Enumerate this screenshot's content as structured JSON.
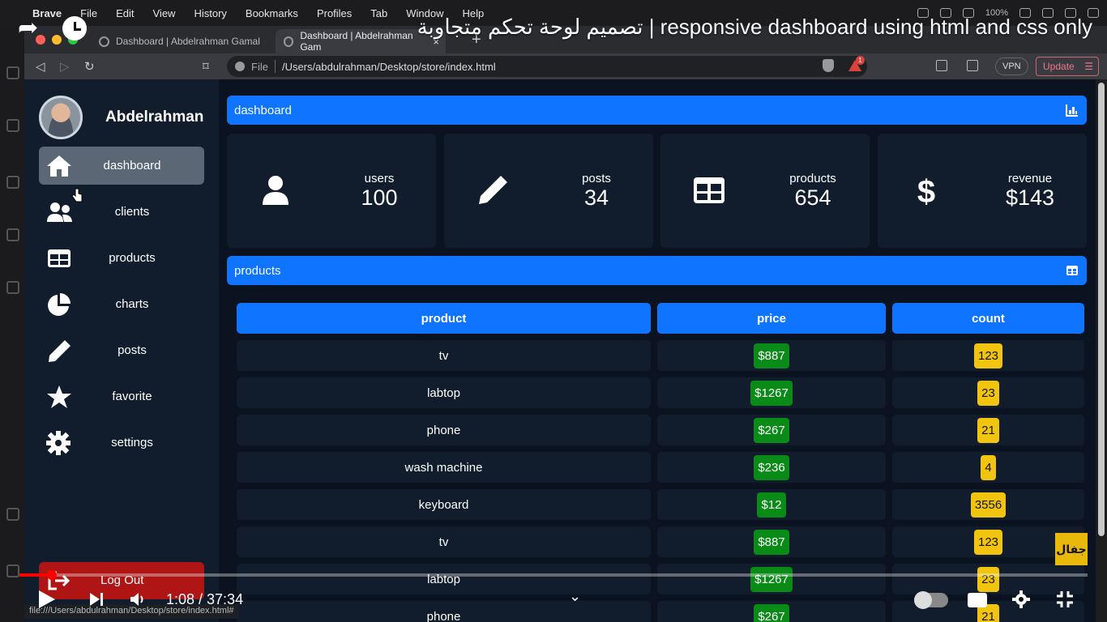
{
  "menubar": {
    "app": "Brave",
    "items": [
      "File",
      "Edit",
      "View",
      "History",
      "Bookmarks",
      "Profiles",
      "Tab",
      "Window",
      "Help"
    ],
    "battery": "100%"
  },
  "video": {
    "title": "تصميم لوحة تحكم متجاوبة | responsive dashboard using html and css only",
    "time": "1:08 / 37:34",
    "progress": 0.03,
    "channel_badge": "جفال"
  },
  "browser": {
    "tabs": [
      {
        "title": "Dashboard | Abdelrahman Gamal"
      },
      {
        "title": "Dashboard | Abdelrahman Gam"
      }
    ],
    "address_scheme": "File",
    "address": "/Users/abdulrahman/Desktop/store/index.html",
    "rewards_count": "1",
    "vpn": "VPN",
    "update": "Update",
    "status_url": "file:///Users/abdulrahman/Desktop/store/index.html#"
  },
  "sidebar": {
    "user_name": "Abdelrahman",
    "items": [
      {
        "label": "dashboard",
        "icon": "home-icon"
      },
      {
        "label": "clients",
        "icon": "users-icon"
      },
      {
        "label": "products",
        "icon": "table-icon"
      },
      {
        "label": "charts",
        "icon": "pie-chart-icon"
      },
      {
        "label": "posts",
        "icon": "pencil-icon"
      },
      {
        "label": "favorite",
        "icon": "star-icon"
      },
      {
        "label": "settings",
        "icon": "gear-icon"
      }
    ],
    "logout": "Log Out"
  },
  "main": {
    "dashboard_header": "dashboard",
    "products_header": "products",
    "cards": [
      {
        "label": "users",
        "value": "100",
        "icon": "user-icon"
      },
      {
        "label": "posts",
        "value": "34",
        "icon": "pencil-icon"
      },
      {
        "label": "products",
        "value": "654",
        "icon": "table-icon"
      },
      {
        "label": "revenue",
        "value": "$143",
        "icon": "dollar-icon"
      }
    ],
    "table": {
      "columns": [
        "product",
        "price",
        "count"
      ],
      "rows": [
        {
          "product": "tv",
          "price": "$887",
          "count": "123"
        },
        {
          "product": "labtop",
          "price": "$1267",
          "count": "23"
        },
        {
          "product": "phone",
          "price": "$267",
          "count": "21"
        },
        {
          "product": "wash machine",
          "price": "$236",
          "count": "4"
        },
        {
          "product": "keyboard",
          "price": "$12",
          "count": "3556"
        },
        {
          "product": "tv",
          "price": "$887",
          "count": "123"
        },
        {
          "product": "labtop",
          "price": "$1267",
          "count": "23"
        },
        {
          "product": "phone",
          "price": "$267",
          "count": "21"
        }
      ]
    }
  },
  "colors": {
    "accent": "#0f74ff",
    "panel": "#111c2c",
    "background": "#0b1220",
    "price_badge": "#0a8a16",
    "count_badge": "#f1c40f",
    "logout": "#b01515",
    "active_nav": "#5b6775"
  }
}
